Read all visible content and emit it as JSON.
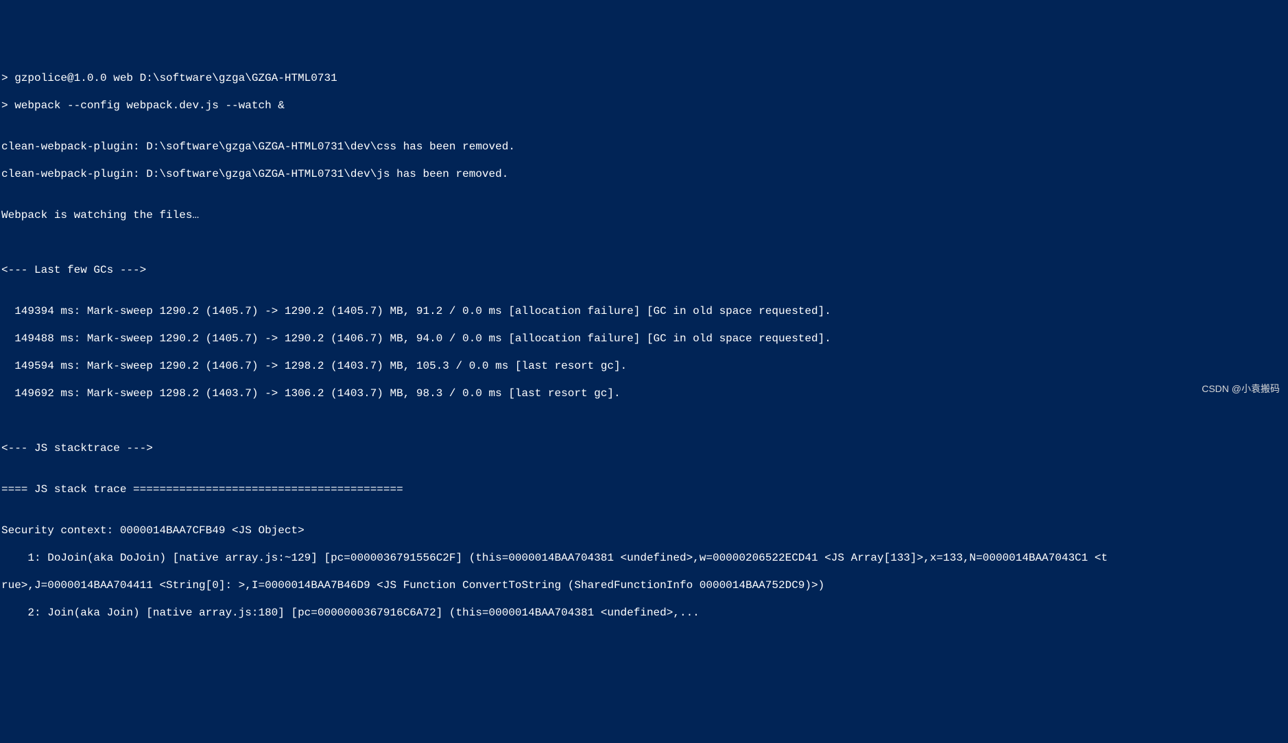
{
  "terminal": {
    "lines": [
      "> gzpolice@1.0.0 web D:\\software\\gzga\\GZGA-HTML0731",
      "> webpack --config webpack.dev.js --watch &",
      "",
      "clean-webpack-plugin: D:\\software\\gzga\\GZGA-HTML0731\\dev\\css has been removed.",
      "clean-webpack-plugin: D:\\software\\gzga\\GZGA-HTML0731\\dev\\js has been removed.",
      "",
      "Webpack is watching the files…",
      "",
      "",
      "<--- Last few GCs --->",
      "",
      "  149394 ms: Mark-sweep 1290.2 (1405.7) -> 1290.2 (1405.7) MB, 91.2 / 0.0 ms [allocation failure] [GC in old space requested].",
      "  149488 ms: Mark-sweep 1290.2 (1405.7) -> 1290.2 (1406.7) MB, 94.0 / 0.0 ms [allocation failure] [GC in old space requested].",
      "  149594 ms: Mark-sweep 1290.2 (1406.7) -> 1298.2 (1403.7) MB, 105.3 / 0.0 ms [last resort gc].",
      "  149692 ms: Mark-sweep 1298.2 (1403.7) -> 1306.2 (1403.7) MB, 98.3 / 0.0 ms [last resort gc].",
      "",
      "",
      "<--- JS stacktrace --->",
      "",
      "==== JS stack trace =========================================",
      "",
      "Security context: 0000014BAA7CFB49 <JS Object>",
      "    1: DoJoin(aka DoJoin) [native array.js:~129] [pc=0000036791556C2F] (this=0000014BAA704381 <undefined>,w=00000206522ECD41 <JS Array[133]>,x=133,N=0000014BAA7043C1 <t",
      "rue>,J=0000014BAA704411 <String[0]: >,I=0000014BAA7B46D9 <JS Function ConvertToString (SharedFunctionInfo 0000014BAA752DC9)>)",
      "    2: Join(aka Join) [native array.js:180] [pc=0000000367916C6A72] (this=0000014BAA704381 <undefined>,..."
    ]
  },
  "attribution": "CSDN @小袁搬码",
  "watermark_faint": ""
}
